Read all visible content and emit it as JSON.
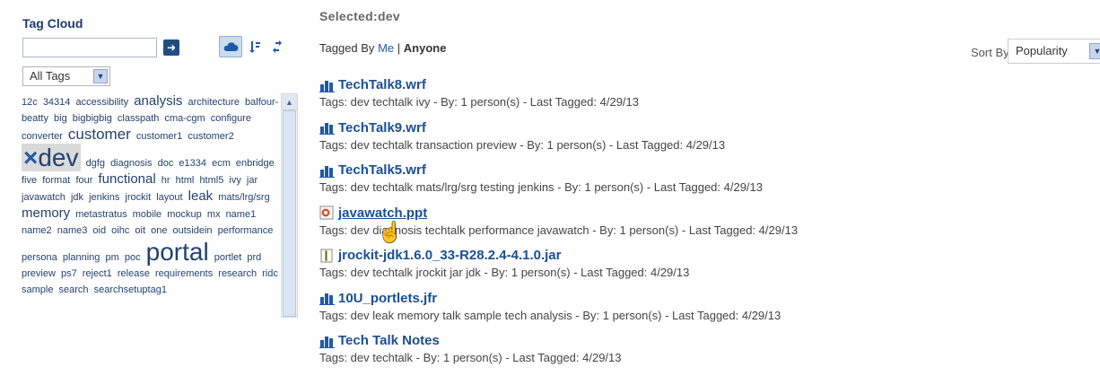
{
  "tag_panel": {
    "title": "Tag Cloud",
    "search": {
      "value": "",
      "placeholder": ""
    },
    "filter_selected": "All Tags",
    "tags": [
      {
        "text": "12c",
        "size": 11
      },
      {
        "text": "34314",
        "size": 11
      },
      {
        "text": "accessibility",
        "size": 11
      },
      {
        "text": "analysis",
        "size": 15
      },
      {
        "text": "architecture",
        "size": 11
      },
      {
        "text": "balfour-beatty",
        "size": 11
      },
      {
        "text": "big",
        "size": 11
      },
      {
        "text": "bigbigbig",
        "size": 11
      },
      {
        "text": "classpath",
        "size": 11
      },
      {
        "text": "cma-cgm",
        "size": 11
      },
      {
        "text": "configure",
        "size": 11
      },
      {
        "text": "converter",
        "size": 11
      },
      {
        "text": "customer",
        "size": 17
      },
      {
        "text": "customer1",
        "size": 11
      },
      {
        "text": "customer2",
        "size": 11
      },
      {
        "text": "dev",
        "size": 28,
        "selected": true
      },
      {
        "text": "dgfg",
        "size": 11
      },
      {
        "text": "diagnosis",
        "size": 11
      },
      {
        "text": "doc",
        "size": 11
      },
      {
        "text": "e1334",
        "size": 11
      },
      {
        "text": "ecm",
        "size": 11
      },
      {
        "text": "enbridge",
        "size": 11
      },
      {
        "text": "five",
        "size": 11
      },
      {
        "text": "format",
        "size": 11
      },
      {
        "text": "four",
        "size": 11
      },
      {
        "text": "functional",
        "size": 15
      },
      {
        "text": "hr",
        "size": 11
      },
      {
        "text": "html",
        "size": 11
      },
      {
        "text": "html5",
        "size": 11
      },
      {
        "text": "ivy",
        "size": 11
      },
      {
        "text": "jar",
        "size": 11
      },
      {
        "text": "javawatch",
        "size": 11
      },
      {
        "text": "jdk",
        "size": 11
      },
      {
        "text": "jenkins",
        "size": 11
      },
      {
        "text": "jrockit",
        "size": 11
      },
      {
        "text": "layout",
        "size": 11
      },
      {
        "text": "leak",
        "size": 15
      },
      {
        "text": "mats/lrg/srg",
        "size": 11
      },
      {
        "text": "memory",
        "size": 15
      },
      {
        "text": "metastratus",
        "size": 11
      },
      {
        "text": "mobile",
        "size": 11
      },
      {
        "text": "mockup",
        "size": 11
      },
      {
        "text": "mx",
        "size": 11
      },
      {
        "text": "name1",
        "size": 11
      },
      {
        "text": "name2",
        "size": 11
      },
      {
        "text": "name3",
        "size": 11
      },
      {
        "text": "oid",
        "size": 11
      },
      {
        "text": "oihc",
        "size": 11
      },
      {
        "text": "oit",
        "size": 11
      },
      {
        "text": "one",
        "size": 11
      },
      {
        "text": "outsidein",
        "size": 11
      },
      {
        "text": "performance",
        "size": 11
      },
      {
        "text": "persona",
        "size": 11
      },
      {
        "text": "planning",
        "size": 11
      },
      {
        "text": "pm",
        "size": 11
      },
      {
        "text": "poc",
        "size": 11
      },
      {
        "text": "portal",
        "size": 28
      },
      {
        "text": "portlet",
        "size": 11
      },
      {
        "text": "prd",
        "size": 11
      },
      {
        "text": "preview",
        "size": 11
      },
      {
        "text": "ps7",
        "size": 11
      },
      {
        "text": "reject1",
        "size": 11
      },
      {
        "text": "release",
        "size": 11
      },
      {
        "text": "requirements",
        "size": 11
      },
      {
        "text": "research",
        "size": 11
      },
      {
        "text": "ridc",
        "size": 11
      },
      {
        "text": "sample",
        "size": 11
      },
      {
        "text": "search",
        "size": 11
      },
      {
        "text": "searchsetuptag1",
        "size": 11
      }
    ]
  },
  "results": {
    "selected_label": "Selected:",
    "selected_value": "dev",
    "tagged_by_prefix": "Tagged By",
    "tagged_by_me": "Me",
    "tagged_by_sep": "|",
    "tagged_by_anyone": "Anyone",
    "sort_label": "Sort By",
    "sort_value": "Popularity",
    "items": [
      {
        "title": "TechTalk8.wrf",
        "icon": "chart-file-icon",
        "meta": "Tags: dev techtalk ivy - By: 1 person(s) - Last Tagged: 4/29/13"
      },
      {
        "title": "TechTalk9.wrf",
        "icon": "chart-file-icon",
        "meta": "Tags: dev techtalk transaction preview - By: 1 person(s) - Last Tagged: 4/29/13"
      },
      {
        "title": "TechTalk5.wrf",
        "icon": "chart-file-icon",
        "meta": "Tags: dev techtalk mats/lrg/srg testing jenkins - By: 1 person(s) - Last Tagged: 4/29/13"
      },
      {
        "title": "javawatch.ppt",
        "icon": "powerpoint-file-icon",
        "meta": "Tags: dev diagnosis techtalk performance javawatch - By: 1 person(s) - Last Tagged: 4/29/13"
      },
      {
        "title": "jrockit-jdk1.6.0_33-R28.2.4-4.1.0.jar",
        "icon": "archive-file-icon",
        "meta": "Tags: dev techtalk jrockit jar jdk - By: 1 person(s) - Last Tagged: 4/29/13"
      },
      {
        "title": "10U_portlets.jfr",
        "icon": "chart-file-icon",
        "meta": "Tags: dev leak memory talk sample tech analysis - By: 1 person(s) - Last Tagged: 4/29/13"
      },
      {
        "title": "Tech Talk Notes",
        "icon": "chart-file-icon",
        "meta": "Tags: dev techtalk - By: 1 person(s) - Last Tagged: 4/29/13"
      }
    ]
  }
}
